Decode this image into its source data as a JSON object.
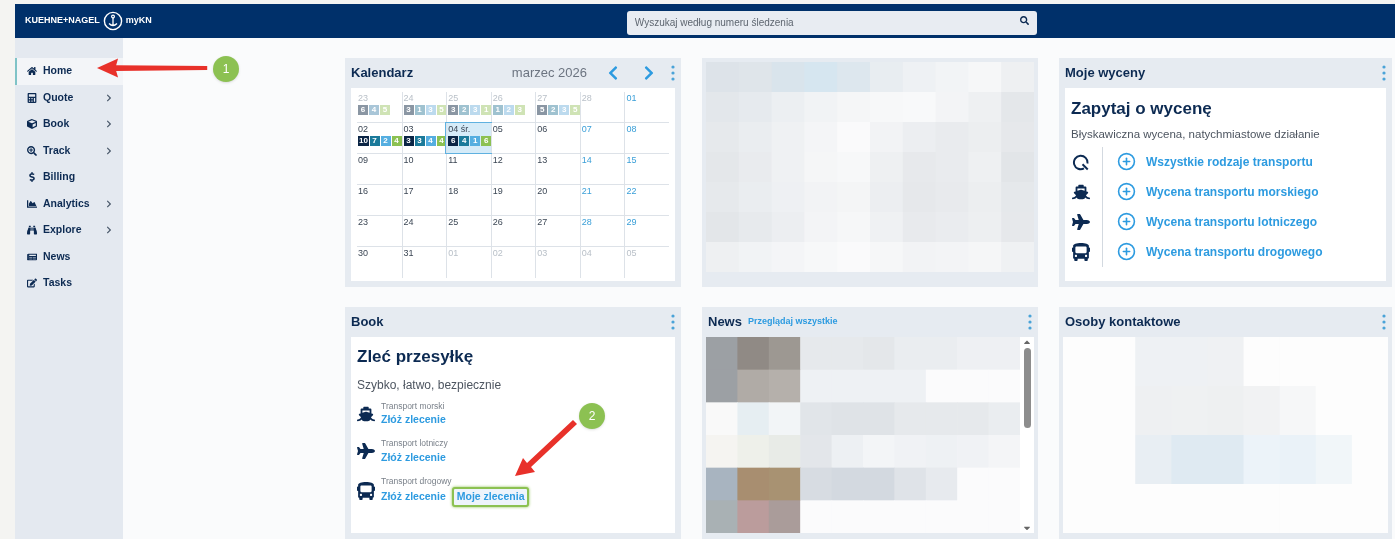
{
  "header": {
    "brand": "KUEHNE+NAGEL",
    "product": "myKN",
    "search": {
      "placeholder": "Wyszukaj według numeru śledzenia"
    }
  },
  "sidebar": {
    "items": [
      {
        "label": "Home",
        "kind": "home",
        "expandable": false,
        "selected": true
      },
      {
        "label": "Quote",
        "kind": "calculator",
        "expandable": true,
        "selected": false
      },
      {
        "label": "Book",
        "kind": "box",
        "expandable": true,
        "selected": false
      },
      {
        "label": "Track",
        "kind": "track",
        "expandable": true,
        "selected": false
      },
      {
        "label": "Billing",
        "kind": "dollar",
        "expandable": false,
        "selected": false
      },
      {
        "label": "Analytics",
        "kind": "chart",
        "expandable": true,
        "selected": false
      },
      {
        "label": "Explore",
        "kind": "binoculars",
        "expandable": true,
        "selected": false
      },
      {
        "label": "News",
        "kind": "news",
        "expandable": false,
        "selected": false
      },
      {
        "label": "Tasks",
        "kind": "tasks",
        "expandable": false,
        "selected": false
      }
    ]
  },
  "calendar": {
    "title": "Kalendarz",
    "month": "marzec 2026",
    "weeks": [
      [
        {
          "day": "23",
          "kind": "other",
          "chips": [
            {
              "n": "6",
              "color": "#8a96a3"
            },
            {
              "n": "4",
              "color": "#a9c6d8"
            },
            {
              "n": "5",
              "color": "#cfe3b5"
            }
          ]
        },
        {
          "day": "24",
          "kind": "other",
          "chips": [
            {
              "n": "3",
              "color": "#8a96a3"
            },
            {
              "n": "1",
              "color": "#9fc2d0"
            },
            {
              "n": "3",
              "color": "#bcdaee"
            },
            {
              "n": "5",
              "color": "#cfe3b5"
            }
          ]
        },
        {
          "day": "25",
          "kind": "other",
          "chips": [
            {
              "n": "3",
              "color": "#8a96a3"
            },
            {
              "n": "2",
              "color": "#9fc2d0"
            },
            {
              "n": "3",
              "color": "#bcdaee"
            },
            {
              "n": "1",
              "color": "#cfe3b5"
            }
          ]
        },
        {
          "day": "26",
          "kind": "other",
          "chips": [
            {
              "n": "1",
              "color": "#9fc2d0"
            },
            {
              "n": "2",
              "color": "#bcdaee"
            },
            {
              "n": "3",
              "color": "#cfe3b5"
            }
          ]
        },
        {
          "day": "27",
          "kind": "other",
          "chips": [
            {
              "n": "5",
              "color": "#8a96a3"
            },
            {
              "n": "2",
              "color": "#9fc2d0"
            },
            {
              "n": "3",
              "color": "#bcdaee"
            },
            {
              "n": "5",
              "color": "#cfe3b5"
            }
          ]
        },
        {
          "day": "28",
          "kind": "other"
        },
        {
          "day": "01",
          "kind": "weekend"
        }
      ],
      [
        {
          "day": "02",
          "kind": "normal",
          "chips": [
            {
              "n": "10",
              "color": "#0b2545"
            },
            {
              "n": "7",
              "color": "#1b7a9a"
            },
            {
              "n": "2",
              "color": "#55aee0"
            },
            {
              "n": "4",
              "color": "#8cc152"
            }
          ]
        },
        {
          "day": "03",
          "kind": "normal",
          "chips": [
            {
              "n": "3",
              "color": "#0b2545"
            },
            {
              "n": "3",
              "color": "#1b7a9a"
            },
            {
              "n": "4",
              "color": "#55aee0"
            },
            {
              "n": "4",
              "color": "#8cc152"
            }
          ]
        },
        {
          "day": "04 śr.",
          "kind": "today",
          "chips": [
            {
              "n": "6",
              "color": "#0b2545"
            },
            {
              "n": "4",
              "color": "#1b7a9a"
            },
            {
              "n": "1",
              "color": "#55aee0"
            },
            {
              "n": "6",
              "color": "#8cc152"
            }
          ]
        },
        {
          "day": "05",
          "kind": "normal"
        },
        {
          "day": "06",
          "kind": "normal"
        },
        {
          "day": "07",
          "kind": "weekend"
        },
        {
          "day": "08",
          "kind": "weekend"
        }
      ],
      [
        {
          "day": "09",
          "kind": "normal"
        },
        {
          "day": "10",
          "kind": "normal"
        },
        {
          "day": "11",
          "kind": "normal"
        },
        {
          "day": "12",
          "kind": "normal"
        },
        {
          "day": "13",
          "kind": "normal"
        },
        {
          "day": "14",
          "kind": "weekend"
        },
        {
          "day": "15",
          "kind": "weekend"
        }
      ],
      [
        {
          "day": "16",
          "kind": "normal"
        },
        {
          "day": "17",
          "kind": "normal"
        },
        {
          "day": "18",
          "kind": "normal"
        },
        {
          "day": "19",
          "kind": "normal"
        },
        {
          "day": "20",
          "kind": "normal"
        },
        {
          "day": "21",
          "kind": "weekend"
        },
        {
          "day": "22",
          "kind": "weekend"
        }
      ],
      [
        {
          "day": "23",
          "kind": "normal"
        },
        {
          "day": "24",
          "kind": "normal"
        },
        {
          "day": "25",
          "kind": "normal"
        },
        {
          "day": "26",
          "kind": "normal"
        },
        {
          "day": "27",
          "kind": "normal"
        },
        {
          "day": "28",
          "kind": "weekend"
        },
        {
          "day": "29",
          "kind": "weekend"
        }
      ],
      [
        {
          "day": "30",
          "kind": "normal"
        },
        {
          "day": "31",
          "kind": "normal"
        },
        {
          "day": "01",
          "kind": "other"
        },
        {
          "day": "02",
          "kind": "other"
        },
        {
          "day": "03",
          "kind": "other"
        },
        {
          "day": "04",
          "kind": "other"
        },
        {
          "day": "05",
          "kind": "other"
        }
      ]
    ]
  },
  "quotes": {
    "title": "Moje wyceny",
    "heading": "Zapytaj o wycenę",
    "subtitle": "Błyskawiczna wycena, natychmiastowe działanie",
    "links": [
      {
        "kind": "all",
        "label": "Wszystkie rodzaje transportu"
      },
      {
        "kind": "ship",
        "label": "Wycena transportu morskiego"
      },
      {
        "kind": "plane",
        "label": "Wycena transportu lotniczego"
      },
      {
        "kind": "bus",
        "label": "Wycena transportu drogowego"
      }
    ]
  },
  "book": {
    "title": "Book",
    "heading": "Zleć przesyłkę",
    "subtitle": "Szybko, łatwo, bezpiecznie",
    "modes": [
      {
        "kind": "ship",
        "label": "Transport morski",
        "links": [
          {
            "label": "Złóż zlecenie",
            "highlighted": false
          }
        ]
      },
      {
        "kind": "plane",
        "label": "Transport lotniczy",
        "links": [
          {
            "label": "Złóż zlecenie",
            "highlighted": false
          }
        ]
      },
      {
        "kind": "bus",
        "label": "Transport drogowy",
        "links": [
          {
            "label": "Złóż zlecenie",
            "highlighted": false
          },
          {
            "label": "Moje zlecenia",
            "highlighted": true
          }
        ]
      }
    ]
  },
  "news": {
    "title": "News",
    "link": "Przeglądaj wszystkie"
  },
  "contacts": {
    "title": "Osoby kontaktowe"
  },
  "annotations": [
    {
      "label": "1"
    },
    {
      "label": "2"
    }
  ]
}
